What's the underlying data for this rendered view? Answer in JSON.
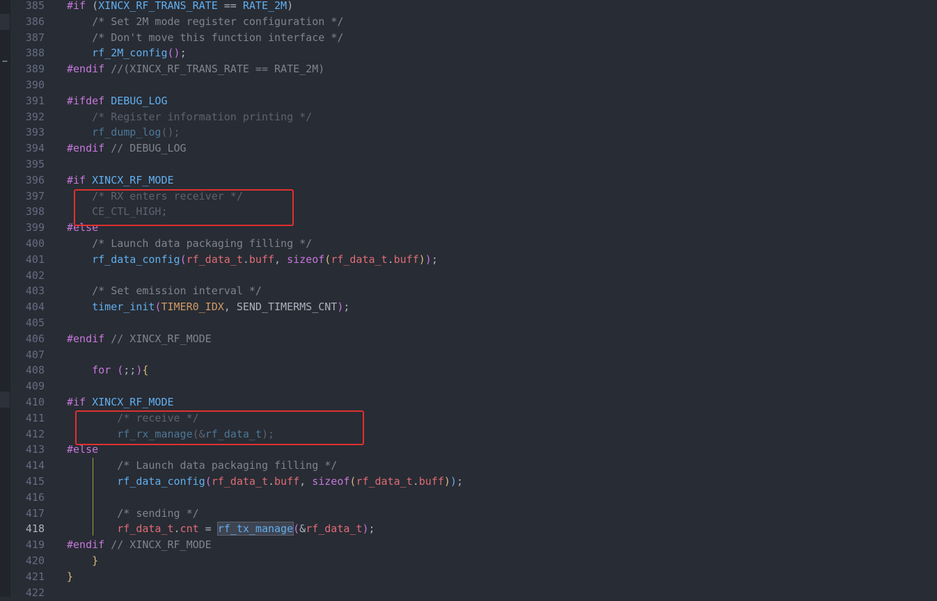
{
  "editor": {
    "active_line": "418",
    "lines": [
      {
        "n": "385",
        "segs": [
          {
            "c": "dir",
            "t": "#if "
          },
          {
            "c": "pl",
            "t": "("
          },
          {
            "c": "mac",
            "t": "XINCX_RF_TRANS_RATE"
          },
          {
            "c": "pl",
            "t": " == "
          },
          {
            "c": "mac",
            "t": "RATE_2M"
          },
          {
            "c": "pl",
            "t": ")"
          }
        ]
      },
      {
        "n": "386",
        "segs": [
          {
            "c": "cm",
            "t": "    /* Set 2M mode register configuration */"
          }
        ]
      },
      {
        "n": "387",
        "segs": [
          {
            "c": "cm",
            "t": "    /* Don't move this function interface */"
          }
        ]
      },
      {
        "n": "388",
        "segs": [
          {
            "c": "pl",
            "t": "    "
          },
          {
            "c": "fn",
            "t": "rf_2M_config"
          },
          {
            "c": "br1",
            "t": "()"
          },
          {
            "c": "pl",
            "t": ";"
          }
        ]
      },
      {
        "n": "389",
        "segs": [
          {
            "c": "dir",
            "t": "#endif"
          },
          {
            "c": "cm",
            "t": " //(XINCX_RF_TRANS_RATE == RATE_2M)"
          }
        ]
      },
      {
        "n": "390",
        "segs": []
      },
      {
        "n": "391",
        "segs": [
          {
            "c": "dir",
            "t": "#ifdef "
          },
          {
            "c": "mac",
            "t": "DEBUG_LOG"
          }
        ]
      },
      {
        "n": "392",
        "segs": [
          {
            "c": "cmd",
            "t": "    /* Register information printing */"
          }
        ]
      },
      {
        "n": "393",
        "segs": [
          {
            "c": "pl",
            "t": "    "
          },
          {
            "c": "dimfn",
            "t": "rf_dump_log"
          },
          {
            "c": "dim",
            "t": "();"
          }
        ]
      },
      {
        "n": "394",
        "segs": [
          {
            "c": "dir",
            "t": "#endif"
          },
          {
            "c": "cm",
            "t": " // DEBUG_LOG"
          }
        ]
      },
      {
        "n": "395",
        "segs": []
      },
      {
        "n": "396",
        "segs": [
          {
            "c": "dir",
            "t": "#if "
          },
          {
            "c": "mac",
            "t": "XINCX_RF_MODE"
          }
        ]
      },
      {
        "n": "397",
        "segs": [
          {
            "c": "cmd",
            "t": "    /* RX enters receiver */"
          }
        ]
      },
      {
        "n": "398",
        "segs": [
          {
            "c": "dim",
            "t": "    CE_CTL_HIGH;"
          }
        ]
      },
      {
        "n": "399",
        "segs": [
          {
            "c": "dir",
            "t": "#else"
          }
        ]
      },
      {
        "n": "400",
        "segs": [
          {
            "c": "cm",
            "t": "    /* Launch data packaging filling */"
          }
        ]
      },
      {
        "n": "401",
        "segs": [
          {
            "c": "pl",
            "t": "    "
          },
          {
            "c": "fn",
            "t": "rf_data_config"
          },
          {
            "c": "br1",
            "t": "("
          },
          {
            "c": "var",
            "t": "rf_data_t"
          },
          {
            "c": "pl",
            "t": "."
          },
          {
            "c": "var",
            "t": "buff"
          },
          {
            "c": "pl",
            "t": ", "
          },
          {
            "c": "kw",
            "t": "sizeof"
          },
          {
            "c": "br2",
            "t": "("
          },
          {
            "c": "var",
            "t": "rf_data_t"
          },
          {
            "c": "pl",
            "t": "."
          },
          {
            "c": "var",
            "t": "buff"
          },
          {
            "c": "br2",
            "t": ")"
          },
          {
            "c": "br1",
            "t": ")"
          },
          {
            "c": "pl",
            "t": ";"
          }
        ]
      },
      {
        "n": "402",
        "segs": []
      },
      {
        "n": "403",
        "segs": [
          {
            "c": "cm",
            "t": "    /* Set emission interval */"
          }
        ]
      },
      {
        "n": "404",
        "segs": [
          {
            "c": "pl",
            "t": "    "
          },
          {
            "c": "fn",
            "t": "timer_init"
          },
          {
            "c": "br1",
            "t": "("
          },
          {
            "c": "cst",
            "t": "TIMER0_IDX"
          },
          {
            "c": "pl",
            "t": ", "
          },
          {
            "c": "ptext",
            "t": "SEND_TIMERMS_CNT"
          },
          {
            "c": "br1",
            "t": ")"
          },
          {
            "c": "pl",
            "t": ";"
          }
        ]
      },
      {
        "n": "405",
        "segs": []
      },
      {
        "n": "406",
        "segs": [
          {
            "c": "dir",
            "t": "#endif"
          },
          {
            "c": "cm",
            "t": " // XINCX_RF_MODE"
          }
        ]
      },
      {
        "n": "407",
        "segs": []
      },
      {
        "n": "408",
        "segs": [
          {
            "c": "pl",
            "t": "    "
          },
          {
            "c": "kw",
            "t": "for"
          },
          {
            "c": "pl",
            "t": " "
          },
          {
            "c": "br1",
            "t": "("
          },
          {
            "c": "pl",
            "t": ";;"
          },
          {
            "c": "br1",
            "t": ")"
          },
          {
            "c": "br2",
            "t": "{"
          }
        ]
      },
      {
        "n": "409",
        "segs": []
      },
      {
        "n": "410",
        "segs": [
          {
            "c": "dir",
            "t": "#if "
          },
          {
            "c": "mac",
            "t": "XINCX_RF_MODE"
          }
        ]
      },
      {
        "n": "411",
        "segs": [
          {
            "c": "cmd",
            "t": "        /* receive */"
          }
        ]
      },
      {
        "n": "412",
        "segs": [
          {
            "c": "pl",
            "t": "        "
          },
          {
            "c": "dimfn",
            "t": "rf_rx_manage"
          },
          {
            "c": "dim",
            "t": "(&"
          },
          {
            "c": "dimfn",
            "t": "rf_data_t"
          },
          {
            "c": "dim",
            "t": ");"
          }
        ]
      },
      {
        "n": "413",
        "segs": [
          {
            "c": "dir",
            "t": "#else"
          }
        ]
      },
      {
        "n": "414",
        "segs": [
          {
            "c": "cm",
            "t": "        /* Launch data packaging filling */"
          }
        ]
      },
      {
        "n": "415",
        "segs": [
          {
            "c": "pl",
            "t": "        "
          },
          {
            "c": "fn",
            "t": "rf_data_config"
          },
          {
            "c": "br1",
            "t": "("
          },
          {
            "c": "var",
            "t": "rf_data_t"
          },
          {
            "c": "pl",
            "t": "."
          },
          {
            "c": "var",
            "t": "buff"
          },
          {
            "c": "pl",
            "t": ", "
          },
          {
            "c": "kw",
            "t": "sizeof"
          },
          {
            "c": "br2",
            "t": "("
          },
          {
            "c": "var",
            "t": "rf_data_t"
          },
          {
            "c": "pl",
            "t": "."
          },
          {
            "c": "var",
            "t": "buff"
          },
          {
            "c": "br2",
            "t": ")"
          },
          {
            "c": "br3",
            "t": ")"
          },
          {
            "c": "pl",
            "t": ";"
          }
        ]
      },
      {
        "n": "416",
        "segs": []
      },
      {
        "n": "417",
        "segs": [
          {
            "c": "cm",
            "t": "        /* sending */"
          }
        ]
      },
      {
        "n": "418",
        "segs": [
          {
            "c": "pl",
            "t": "        "
          },
          {
            "c": "var",
            "t": "rf_data_t"
          },
          {
            "c": "pl",
            "t": "."
          },
          {
            "c": "var",
            "t": "cnt"
          },
          {
            "c": "pl",
            "t": " = "
          },
          {
            "c": "fn sel",
            "t": "rf_tx_manage"
          },
          {
            "c": "br1",
            "t": "("
          },
          {
            "c": "pl",
            "t": "&"
          },
          {
            "c": "var",
            "t": "rf_data_t"
          },
          {
            "c": "br1",
            "t": ")"
          },
          {
            "c": "pl",
            "t": ";"
          }
        ]
      },
      {
        "n": "419",
        "segs": [
          {
            "c": "dir",
            "t": "#endif"
          },
          {
            "c": "cm",
            "t": " // XINCX_RF_MODE"
          }
        ]
      },
      {
        "n": "420",
        "segs": [
          {
            "c": "pl",
            "t": "    "
          },
          {
            "c": "br2",
            "t": "}"
          }
        ]
      },
      {
        "n": "421",
        "segs": [
          {
            "c": "br2",
            "t": "}"
          }
        ]
      },
      {
        "n": "422",
        "segs": []
      }
    ]
  },
  "left_strip": {
    "ellipsis": "…"
  },
  "colors": {
    "background": "#282c34",
    "annotation_box": "#e03030"
  }
}
